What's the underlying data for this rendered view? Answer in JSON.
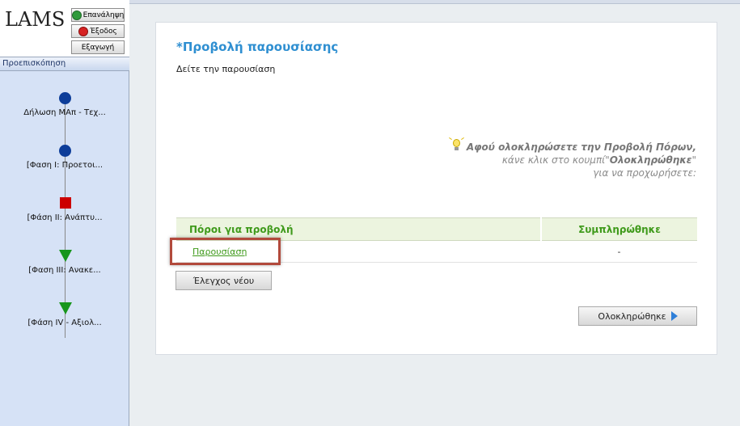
{
  "sidebar": {
    "logo_text": "LAMS",
    "buttons": {
      "restart": "Επανάληψη",
      "exit": "Έξοδος",
      "export": "Εξαγωγή"
    },
    "preview_label": "Προεπισκόπηση",
    "activities": [
      {
        "label": "Δήλωση ΜΑπ - Τεχ...",
        "shape": "circle",
        "color": "#0d3d99"
      },
      {
        "label": "[Φαση Ι: Προετοι...",
        "shape": "circle",
        "color": "#0d3d99"
      },
      {
        "label": "[Φάση ΙΙ: Ανάπτυ...",
        "shape": "square",
        "color": "#cc0000"
      },
      {
        "label": "[Φαση ΙΙΙ: Ανακε...",
        "shape": "triangle",
        "color": "#17961c"
      },
      {
        "label": "[Φάση ΙV - Αξιολ...",
        "shape": "triangle",
        "color": "#17961c"
      }
    ]
  },
  "main": {
    "title": "*Προβολή παρουσίασης",
    "description": "Δείτε την παρουσίαση",
    "hint": {
      "line1": "Αφού ολοκληρώσετε την Προβολή Πόρων,",
      "line2_a": "κάνε κλικ στο κουμπί\"",
      "line2_b": "Ολοκληρώθηκε",
      "line2_c": "\"",
      "line3": "για να προχωρήσετε:"
    },
    "table": {
      "headers": [
        "Πόροι για προβολή",
        "Συμπληρώθηκε"
      ],
      "rows": [
        {
          "resource": "Παρουσίαση",
          "completed": "-"
        }
      ]
    },
    "recheck_button": "Έλεγχος νέου",
    "finish_button": "Ολοκληρώθηκε"
  }
}
